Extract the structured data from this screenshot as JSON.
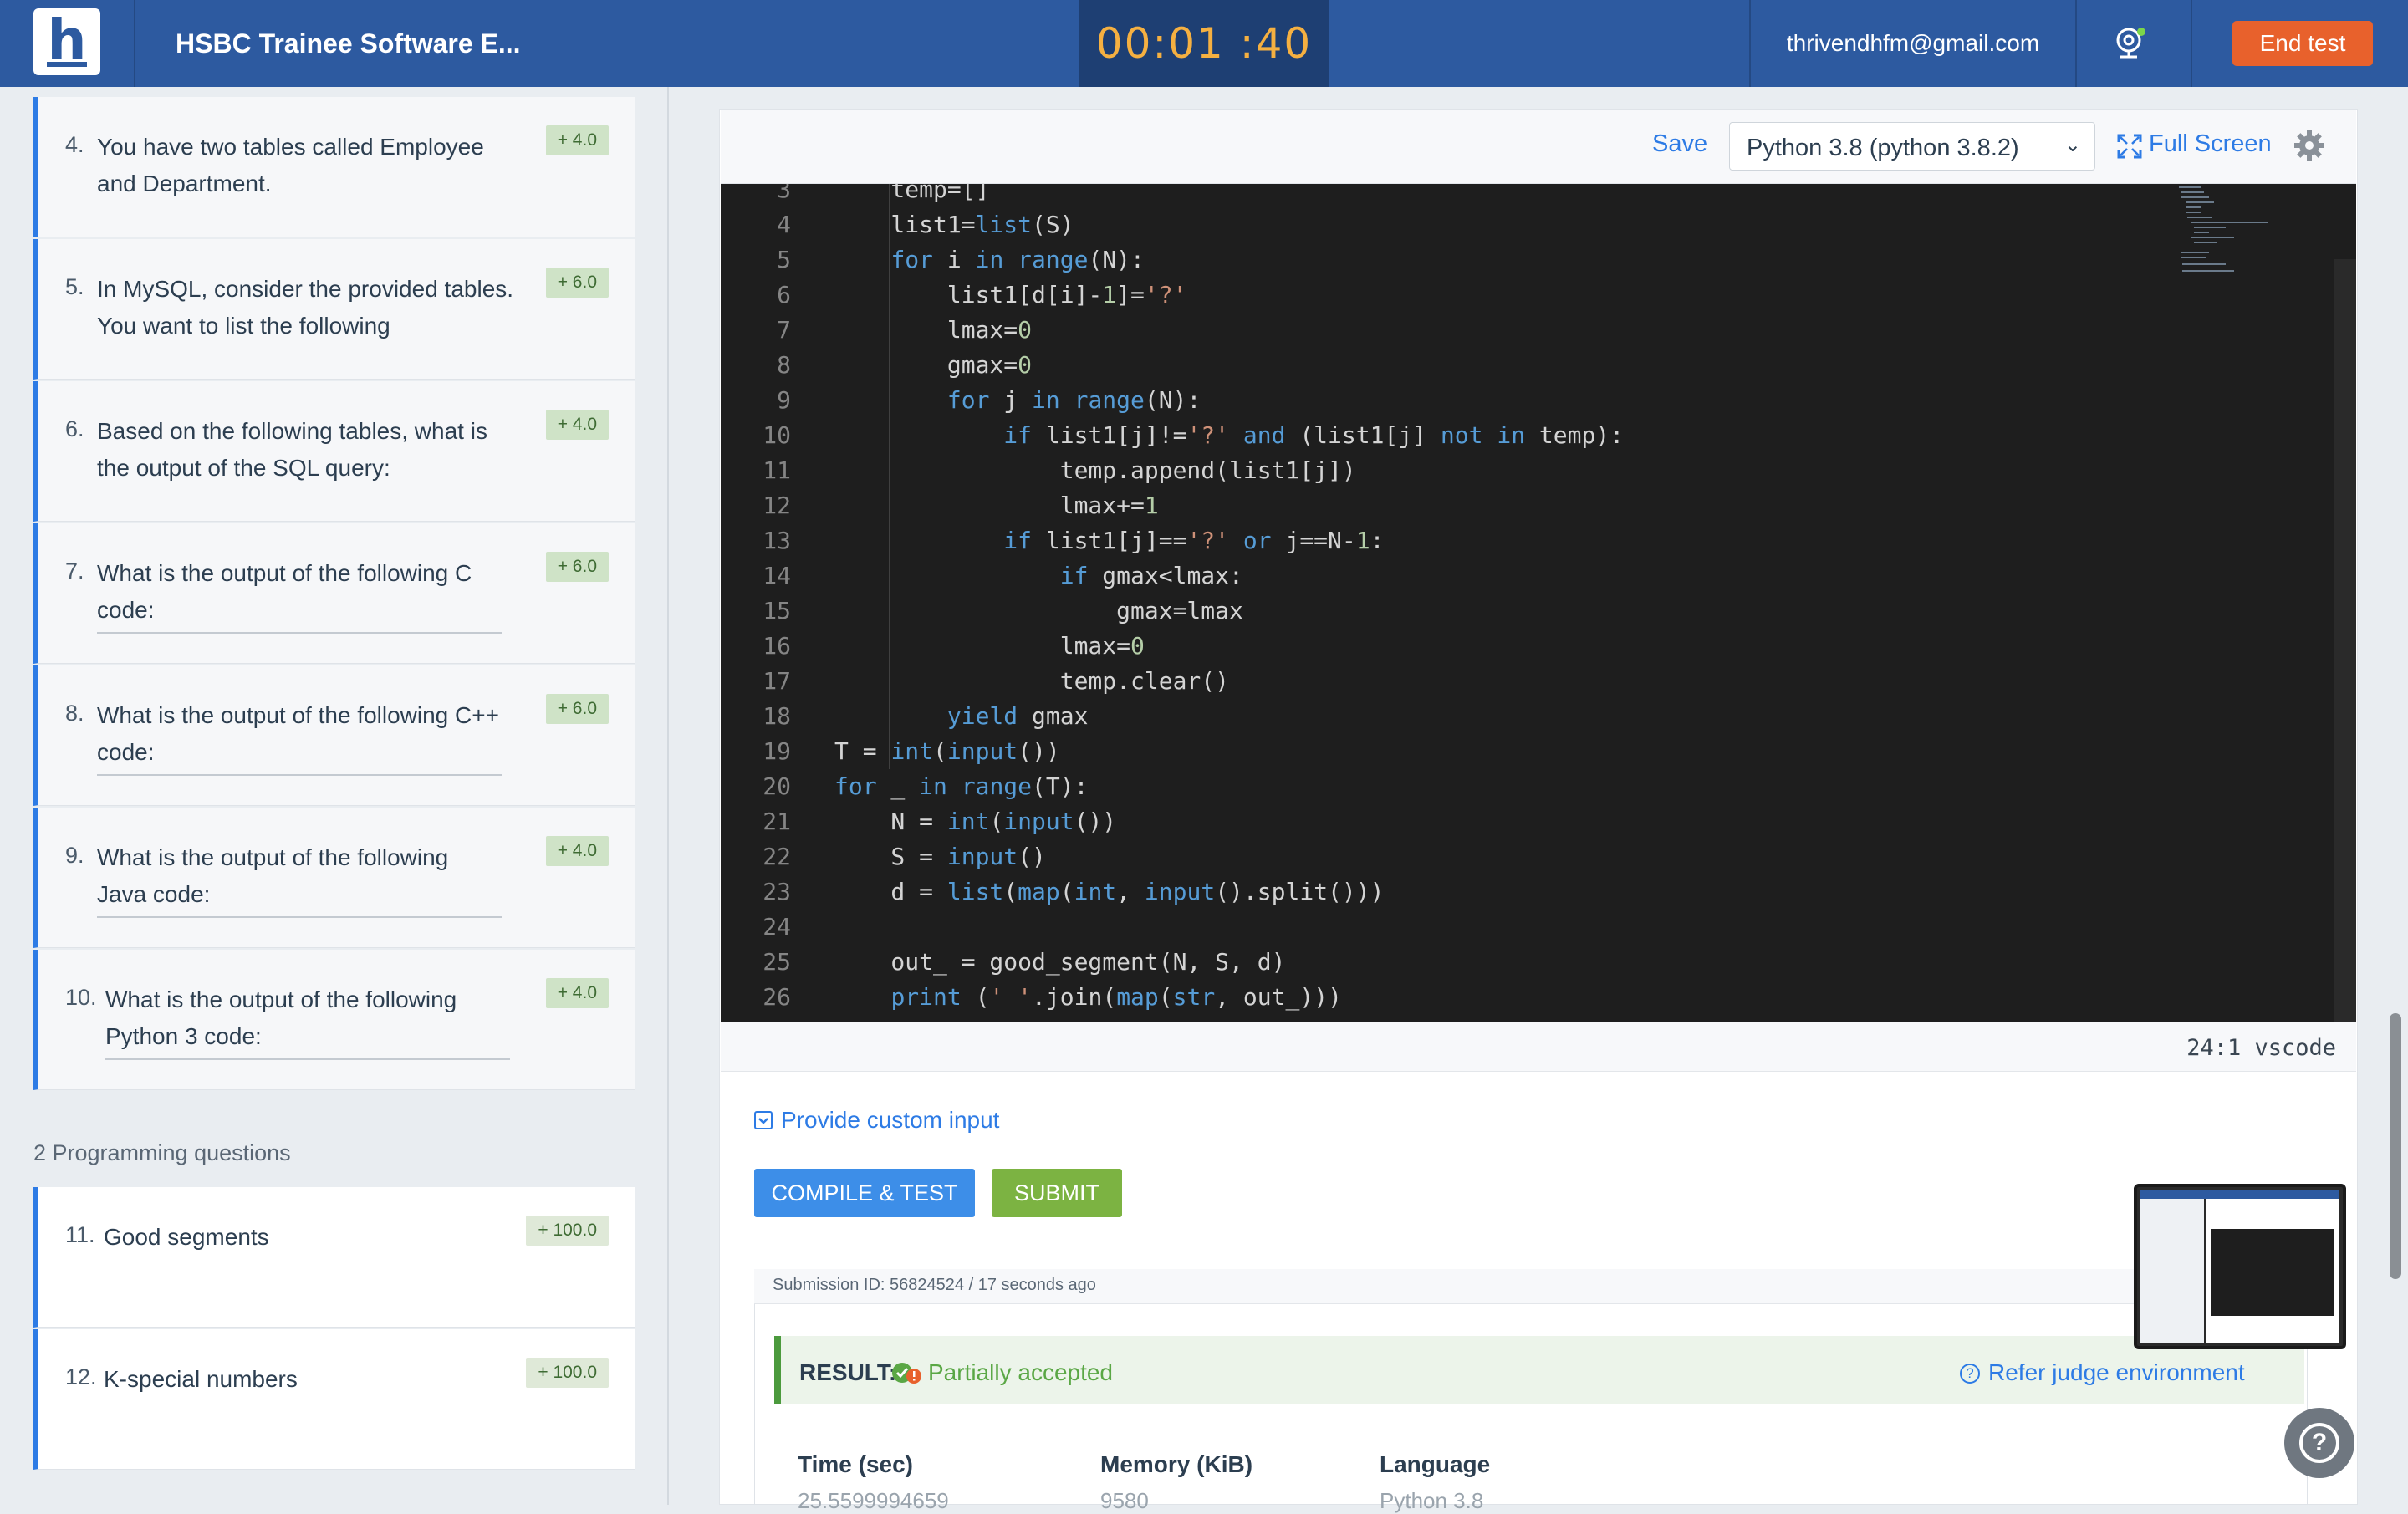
{
  "header": {
    "logo_letter": "h",
    "test_title": "HSBC Trainee Software E...",
    "timer": "00:01 :40",
    "email": "thrivendhfm@gmail.com",
    "end_test_label": "End test",
    "camera_icon": "webcam-icon",
    "brand_color": "#2d5aa0",
    "end_color": "#e8612c"
  },
  "questions": [
    {
      "num": "4.",
      "text": "You have two tables called Employee and Department.",
      "score": "+ 4.0",
      "underlined": false
    },
    {
      "num": "5.",
      "text": "In MySQL, consider the provided tables. You want to list the following",
      "score": "+ 6.0",
      "underlined": false
    },
    {
      "num": "6.",
      "text": "Based on the following tables, what is the output of the SQL query:",
      "score": "+ 4.0",
      "underlined": false
    },
    {
      "num": "7.",
      "text": "What is the output of the following C code:",
      "score": "+ 6.0",
      "underlined": true
    },
    {
      "num": "8.",
      "text": "What is the output of the following C++ code:",
      "score": "+ 6.0",
      "underlined": true
    },
    {
      "num": "9.",
      "text": "What is the output of the following Java code:",
      "score": "+ 4.0",
      "underlined": true
    },
    {
      "num": "10.",
      "text": "What is the output of the following Python 3 code:",
      "score": "+ 4.0",
      "underlined": true
    }
  ],
  "programming": {
    "section_label": "2 Programming questions",
    "items": [
      {
        "num": "11.",
        "text": "Good segments",
        "score": "+ 100.0"
      },
      {
        "num": "12.",
        "text": "K-special numbers",
        "score": "+ 100.0"
      }
    ]
  },
  "toolbar": {
    "save_label": "Save",
    "language": "Python 3.8 (python 3.8.2)",
    "fullscreen_label": "Full Screen",
    "settings_icon": "gear-icon"
  },
  "editor": {
    "lines": [
      {
        "n": "3",
        "code": "    temp=[]"
      },
      {
        "n": "4",
        "code": "    list1=list(S)"
      },
      {
        "n": "5",
        "code": "    for i in range(N):"
      },
      {
        "n": "6",
        "code": "        list1[d[i]-1]='?'"
      },
      {
        "n": "7",
        "code": "        lmax=0"
      },
      {
        "n": "8",
        "code": "        gmax=0"
      },
      {
        "n": "9",
        "code": "        for j in range(N):"
      },
      {
        "n": "10",
        "code": "            if list1[j]!='?' and (list1[j] not in temp):"
      },
      {
        "n": "11",
        "code": "                temp.append(list1[j])"
      },
      {
        "n": "12",
        "code": "                lmax+=1"
      },
      {
        "n": "13",
        "code": "            if list1[j]=='?' or j==N-1:"
      },
      {
        "n": "14",
        "code": "                if gmax<lmax:"
      },
      {
        "n": "15",
        "code": "                    gmax=lmax"
      },
      {
        "n": "16",
        "code": "                lmax=0"
      },
      {
        "n": "17",
        "code": "                temp.clear()"
      },
      {
        "n": "18",
        "code": "        yield gmax"
      },
      {
        "n": "19",
        "code": "T = int(input())"
      },
      {
        "n": "20",
        "code": "for _ in range(T):"
      },
      {
        "n": "21",
        "code": "    N = int(input())"
      },
      {
        "n": "22",
        "code": "    S = input()"
      },
      {
        "n": "23",
        "code": "    d = list(map(int, input().split()))"
      },
      {
        "n": "24",
        "code": ""
      },
      {
        "n": "25",
        "code": "    out_ = good_segment(N, S, d)"
      },
      {
        "n": "26",
        "code": "    print (' '.join(map(str, out_)))"
      }
    ],
    "status": "24:1  vscode"
  },
  "actions": {
    "custom_input_label": "Provide custom input",
    "compile_label": "COMPILE & TEST",
    "submit_label": "SUBMIT"
  },
  "submission": {
    "id_text": "Submission ID: 56824524 / 17 seconds ago",
    "result_label": "RESULT:",
    "result_status": "Partially accepted",
    "judge_link": "Refer judge environment",
    "stats": [
      {
        "label": "Time (sec)",
        "value": "25.5599994659"
      },
      {
        "label": "Memory (KiB)",
        "value": "9580"
      },
      {
        "label": "Language",
        "value": "Python 3.8"
      }
    ]
  }
}
